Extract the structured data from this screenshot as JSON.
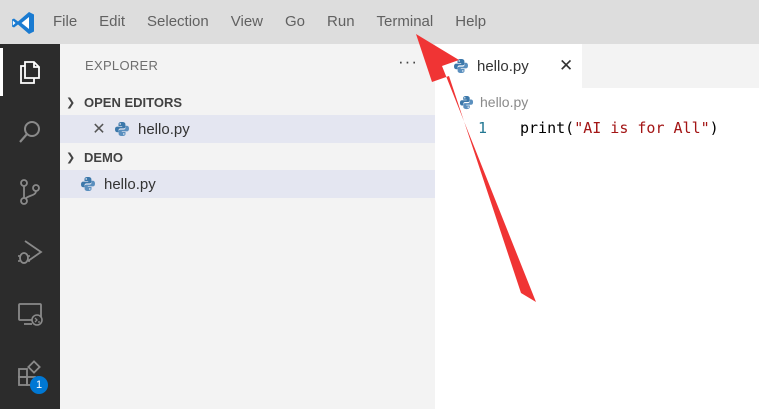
{
  "menu": {
    "items": [
      "File",
      "Edit",
      "Selection",
      "View",
      "Go",
      "Run",
      "Terminal",
      "Help"
    ]
  },
  "activity_bar": {
    "icons": [
      "explorer-icon",
      "search-icon",
      "source-control-icon",
      "run-debug-icon",
      "remote-explorer-icon",
      "extensions-icon"
    ],
    "extensions_badge": "1"
  },
  "sidebar": {
    "title": "EXPLORER",
    "more_label": "···",
    "open_editors": {
      "label": "OPEN EDITORS",
      "files": [
        {
          "name": "hello.py",
          "icon": "python-file-icon"
        }
      ]
    },
    "folder": {
      "label": "DEMO",
      "files": [
        {
          "name": "hello.py",
          "icon": "python-file-icon"
        }
      ]
    }
  },
  "editor": {
    "tab": {
      "name": "hello.py",
      "close_label": "✕"
    },
    "breadcrumb": "hello.py",
    "code": {
      "line_number": "1",
      "fn": "print(",
      "str": "\"AI is for All\"",
      "close": ")"
    }
  },
  "colors": {
    "accent": "#0078d4",
    "annotation_arrow": "#f03434",
    "activity_bar_bg": "#2c2c2c",
    "title_bar_bg": "#dddddd"
  }
}
